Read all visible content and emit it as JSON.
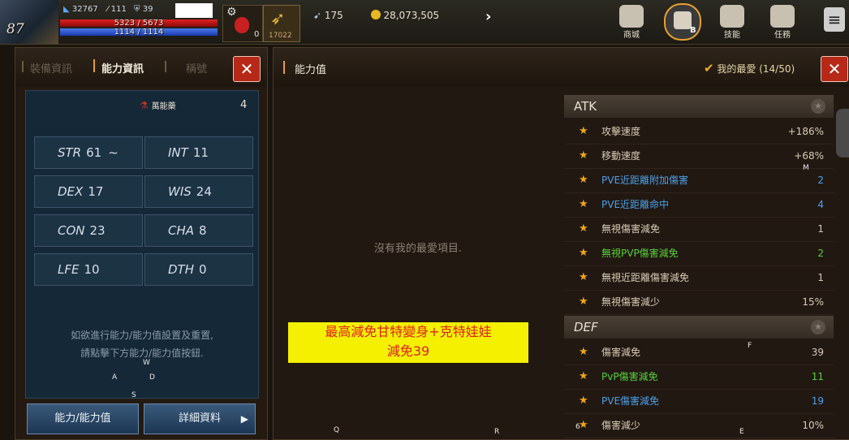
{
  "hud": {
    "level": "87",
    "exp_small": "32767",
    "stat_a": "111",
    "stat_b": "39",
    "hp": "5323 / 5673",
    "mp": "1114 / 1114",
    "potion_count": "0",
    "item_count": "17022",
    "feather_count": "175",
    "gold": "28,073,505"
  },
  "nav": {
    "shop": "商城",
    "skills": "技能",
    "quest": "任務",
    "middle_badge": "B"
  },
  "left": {
    "tab_equip": "裝備資訊",
    "tab_ability": "能力資訊",
    "tab_title": "稱號",
    "elixir_label": "萬能藥",
    "elixir_count": "4",
    "stats": [
      {
        "key": "STR",
        "value": "61"
      },
      {
        "key": "INT",
        "value": "11"
      },
      {
        "key": "DEX",
        "value": "17"
      },
      {
        "key": "WIS",
        "value": "24"
      },
      {
        "key": "CON",
        "value": "23"
      },
      {
        "key": "CHA",
        "value": "8"
      },
      {
        "key": "LFE",
        "value": "10"
      },
      {
        "key": "DTH",
        "value": "0"
      }
    ],
    "hint_line1": "如欲進行能力/能力值設置及重置,",
    "hint_line2": "請點擊下方能力/能力值按鈕.",
    "btn_ability": "能力/能力值",
    "btn_detail": "詳細資料",
    "letters": {
      "w": "W",
      "a": "A",
      "d": "D",
      "s": "S"
    }
  },
  "right": {
    "title": "能力值",
    "fav_label": "我的最愛 (14/50)",
    "empty_msg": "沒有我的最愛項目.",
    "note_line1": "最高減免甘特變身+克特娃娃",
    "note_line2": "減免39",
    "letters": {
      "m": "M",
      "f": "F",
      "q": "Q",
      "r": "R",
      "e": "E",
      "six": "6"
    },
    "atk_header": "ATK",
    "atk_rows": [
      {
        "name": "攻擊速度",
        "value": "+186%",
        "color": "#d8cbb4"
      },
      {
        "name": "移動速度",
        "value": "+68%",
        "color": "#d8cbb4"
      },
      {
        "name": "PVE近距離附加傷害",
        "value": "2",
        "color": "#4aa0e8"
      },
      {
        "name": "PVE近距離命中",
        "value": "4",
        "color": "#4aa0e8"
      },
      {
        "name": "無視傷害減免",
        "value": "1",
        "color": "#d8cbb4"
      },
      {
        "name": "無視PVP傷害減免",
        "value": "2",
        "color": "#58d038"
      },
      {
        "name": "無視近距離傷害減免",
        "value": "1",
        "color": "#d8cbb4"
      },
      {
        "name": "無視傷害減少",
        "value": "15%",
        "color": "#d8cbb4"
      }
    ],
    "def_header": "DEF",
    "def_rows": [
      {
        "name": "傷害減免",
        "value": "39",
        "color": "#d8cbb4"
      },
      {
        "name": "PvP傷害減免",
        "value": "11",
        "color": "#58d038"
      },
      {
        "name": "PVE傷害減免",
        "value": "19",
        "color": "#4aa0e8"
      },
      {
        "name": "傷害減少",
        "value": "10%",
        "color": "#d8cbb4"
      }
    ]
  }
}
